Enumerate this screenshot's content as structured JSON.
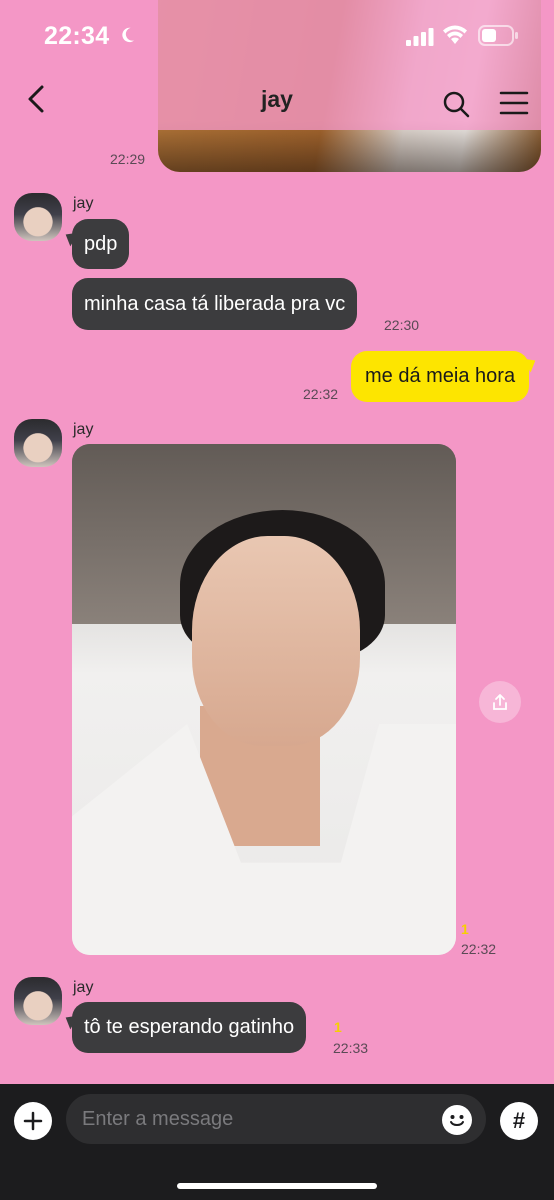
{
  "status": {
    "time": "22:34"
  },
  "header": {
    "title": "jay"
  },
  "messages": [
    {
      "sender": "jay",
      "text": "pdp"
    },
    {
      "sender": "jay",
      "text": "minha casa tá liberada pra vc",
      "time": "22:30"
    },
    {
      "sender": "me",
      "text": "me dá meia hora",
      "time": "22:32"
    },
    {
      "sender": "jay",
      "type": "photo",
      "unread": "1",
      "time": "22:32"
    },
    {
      "sender": "jay",
      "text": "tô te esperando gatinho",
      "unread": "1",
      "time": "22:33"
    }
  ],
  "prev_message_time": "22:29",
  "input": {
    "placeholder": "Enter a message",
    "hash_label": "#"
  },
  "colors": {
    "background": "#f497c6",
    "incoming_bubble": "#3c3c3e",
    "outgoing_bubble": "#fde500",
    "input_bar": "#1c1c1e"
  }
}
